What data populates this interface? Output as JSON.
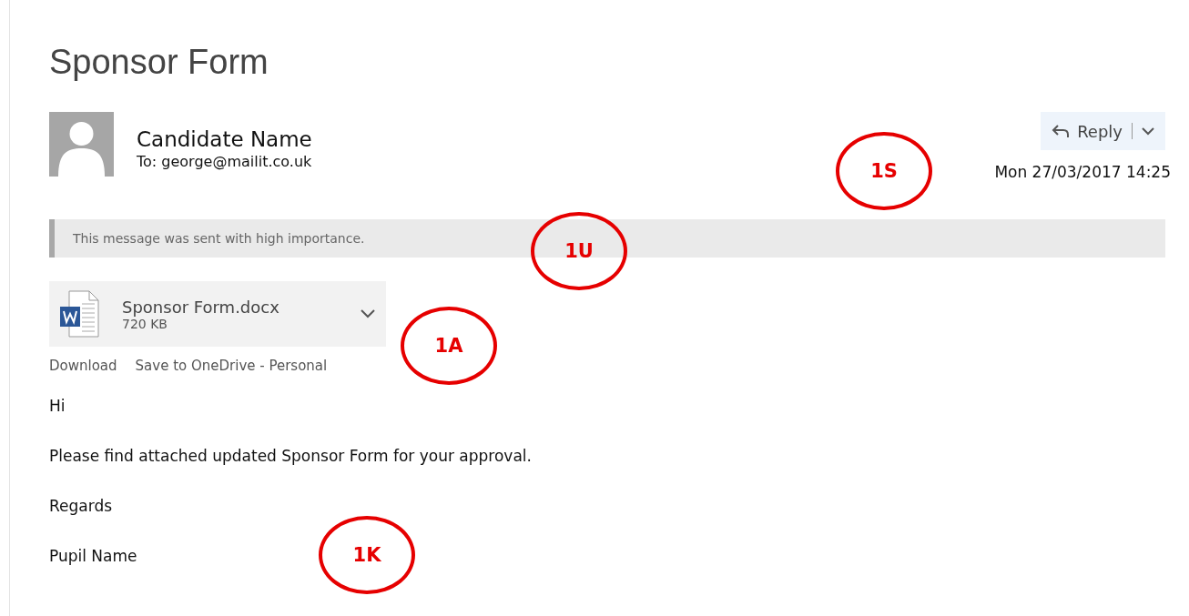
{
  "subject": "Sponsor Form",
  "sender": {
    "name": "Candidate Name",
    "to": "To: george@mailit.co.uk",
    "date": "Mon 27/03/2017 14:25"
  },
  "reply_button": {
    "label": "Reply"
  },
  "importance_banner": "This message was sent with high importance.",
  "attachment": {
    "name": "Sponsor Form.docx",
    "size": "720 KB",
    "actions": [
      "Download",
      "Save to OneDrive - Personal"
    ]
  },
  "body": [
    "Hi",
    "Please find attached updated Sponsor Form for your approval.",
    "Regards",
    "Pupil Name"
  ],
  "callouts": [
    {
      "label": "1S",
      "color": "#e60000"
    },
    {
      "label": "1U",
      "color": "#e60000"
    },
    {
      "label": "1A",
      "color": "#e60000"
    },
    {
      "label": "1K",
      "color": "#e60000"
    }
  ]
}
